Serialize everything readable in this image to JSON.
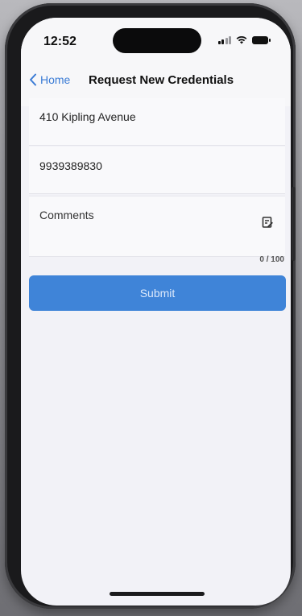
{
  "status_bar": {
    "time": "12:52"
  },
  "nav": {
    "back_label": "Home",
    "title": "Request New Credentials"
  },
  "form": {
    "address_value": "410 Kipling Avenue",
    "phone_value": "9939389830",
    "comments_placeholder": "Comments",
    "comments_counter": "0 / 100",
    "submit_label": "Submit"
  },
  "colors": {
    "accent": "#3f84d8",
    "link": "#3a7bd5",
    "screen_bg": "#f2f2f7"
  },
  "icons": {
    "back": "chevron-left-icon",
    "comments": "note-edit-icon",
    "signal": "cellular-signal-icon",
    "wifi": "wifi-icon",
    "battery": "battery-icon"
  }
}
